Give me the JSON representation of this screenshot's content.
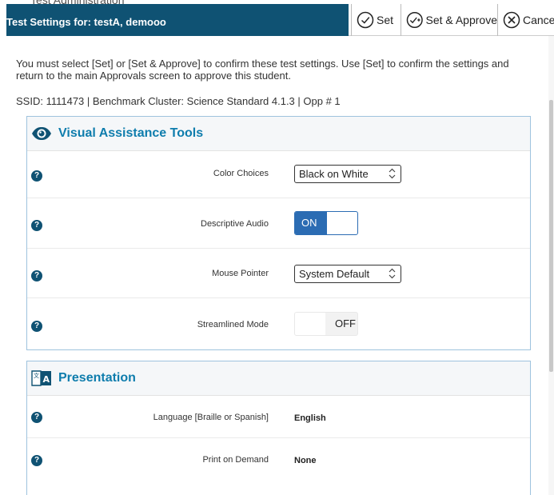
{
  "background_header_text": "Test Administration",
  "dialog": {
    "title": "Test Settings for: testA, demooo",
    "set_label": "Set",
    "set_approve_label": "Set & Approve",
    "cancel_label": "Cancel"
  },
  "intro_text": "You must select [Set] or [Set & Approve] to confirm these test settings. Use [Set] to confirm the settings and return to the main Approvals screen to approve this student.",
  "ids_line": "SSID: 1111473 | Benchmark Cluster: Science Standard 4.1.3 | Opp # 1",
  "visual_tools": {
    "title": "Visual Assistance Tools",
    "icon": "eye-icon",
    "rows": [
      {
        "label": "Color Choices",
        "control": "select",
        "value": "Black on White"
      },
      {
        "label": "Descriptive Audio",
        "control": "toggle",
        "value": "ON"
      },
      {
        "label": "Mouse Pointer",
        "control": "select",
        "value": "System Default"
      },
      {
        "label": "Streamlined Mode",
        "control": "toggle",
        "value": "OFF"
      }
    ]
  },
  "presentation": {
    "title": "Presentation",
    "icon": "translation-icon",
    "rows": [
      {
        "label": "Language [Braille or Spanish]",
        "value": "English"
      },
      {
        "label": "Print on Demand",
        "value": "None"
      }
    ]
  },
  "help_icon_text": "?",
  "colors": {
    "header_bg": "#0f5273",
    "accent": "#0f7dad",
    "toggle_on": "#2b6cb3",
    "panel_border": "#9ec3de"
  }
}
